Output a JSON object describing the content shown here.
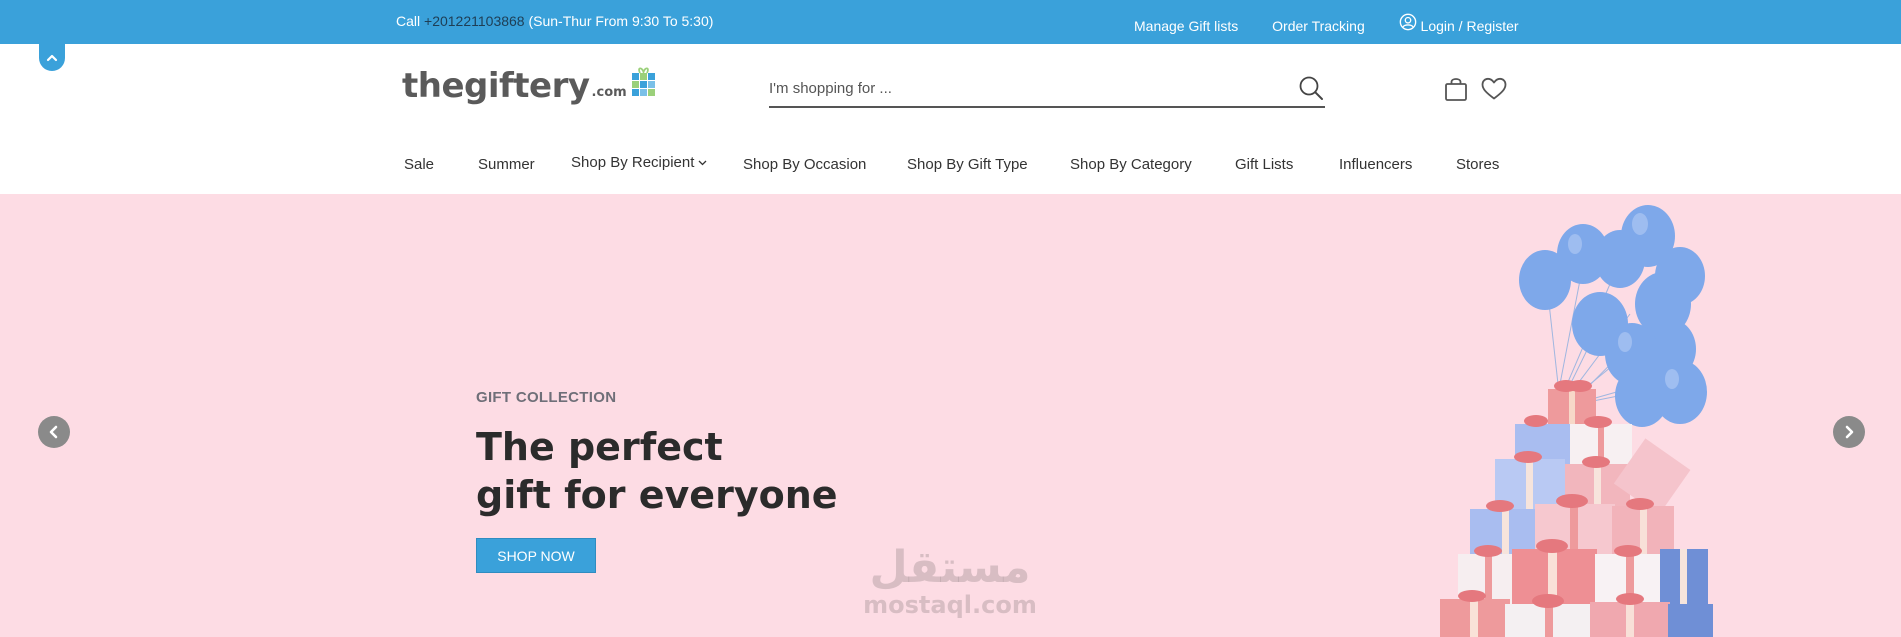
{
  "topbar": {
    "call_prefix": "Call ",
    "phone": "+201221103868",
    "hours": " (Sun-Thur From 9:30 To 5:30)",
    "manage_gift_lists": "Manage Gift lists",
    "order_tracking": "Order Tracking",
    "login_register": "Login / Register"
  },
  "header": {
    "logo_text": "thegiftery",
    "logo_suffix": ".com",
    "search_placeholder": "I'm shopping for ..."
  },
  "nav": {
    "items": [
      "Sale",
      "Summer",
      "Shop By Recipient",
      "Shop By Occasion",
      "Shop By Gift Type",
      "Shop By Category",
      "Gift Lists",
      "Influencers",
      "Stores"
    ]
  },
  "hero": {
    "eyebrow": "GIFT COLLECTION",
    "headline_line1": "The perfect",
    "headline_line2": "gift for everyone",
    "cta": "SHOP NOW"
  },
  "watermark": {
    "arabic": "مستقل",
    "latin": "mostaql.com"
  },
  "colors": {
    "brand_blue": "#3aa1da",
    "hero_pink": "#fddce4",
    "balloon_blue": "#7ea8ea",
    "gift_pink": "#ee9a9c"
  }
}
